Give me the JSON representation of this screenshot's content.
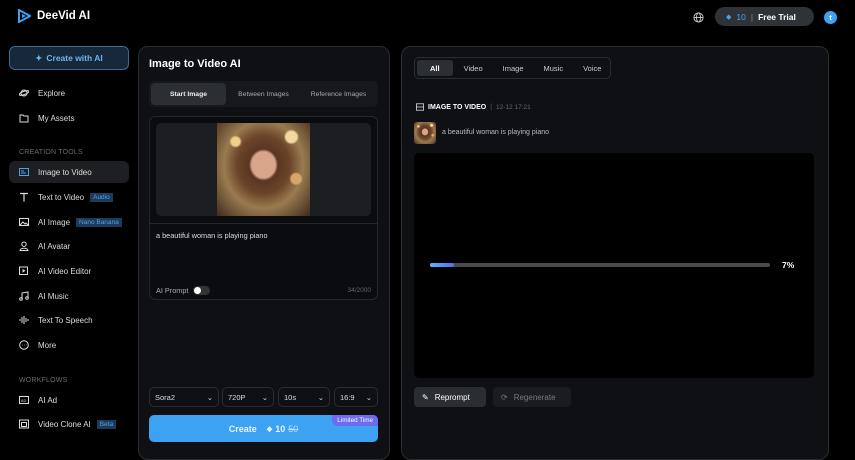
{
  "app": {
    "name": "DeeVid AI"
  },
  "topbar": {
    "credits": "10",
    "plan": "Free Trial",
    "avatar_initial": "t"
  },
  "sidebar": {
    "create_label": "Create with AI",
    "top_items": [
      {
        "label": "Explore"
      },
      {
        "label": "My Assets"
      }
    ],
    "creation_heading": "CREATION TOOLS",
    "creation_items": [
      {
        "label": "Image to Video"
      },
      {
        "label": "Text to Video",
        "badge": "Audio"
      },
      {
        "label": "AI Image",
        "badge": "Nano Banana"
      },
      {
        "label": "AI Avatar"
      },
      {
        "label": "AI Video Editor"
      },
      {
        "label": "AI Music"
      },
      {
        "label": "Text To Speech"
      },
      {
        "label": "More"
      }
    ],
    "workflows_heading": "WORKFLOWS",
    "workflow_items": [
      {
        "label": "AI Ad"
      },
      {
        "label": "Video Clone AI",
        "badge": "Beta"
      }
    ]
  },
  "editor": {
    "title": "Image to Video AI",
    "tabs": [
      "Start Image",
      "Between Images",
      "Reference Images"
    ],
    "prompt": "a beautiful woman is playing piano",
    "ai_prompt_label": "AI Prompt",
    "char_count": "34/2000",
    "model": "Sora2",
    "resolution": "720P",
    "duration": "10s",
    "ratio": "16:9",
    "create_label": "Create",
    "cost": "10",
    "original_cost": "50",
    "promo": "Limited Time"
  },
  "results": {
    "filters": [
      "All",
      "Video",
      "Image",
      "Music",
      "Voice"
    ],
    "job_type": "IMAGE TO VIDEO",
    "job_time": "12-12 17:21",
    "prompt": "a beautiful woman is playing piano",
    "progress_percent": 7,
    "progress_label": "7%",
    "reprompt_label": "Reprompt",
    "regenerate_label": "Regenerate",
    "accent": "#3ea2f2"
  }
}
